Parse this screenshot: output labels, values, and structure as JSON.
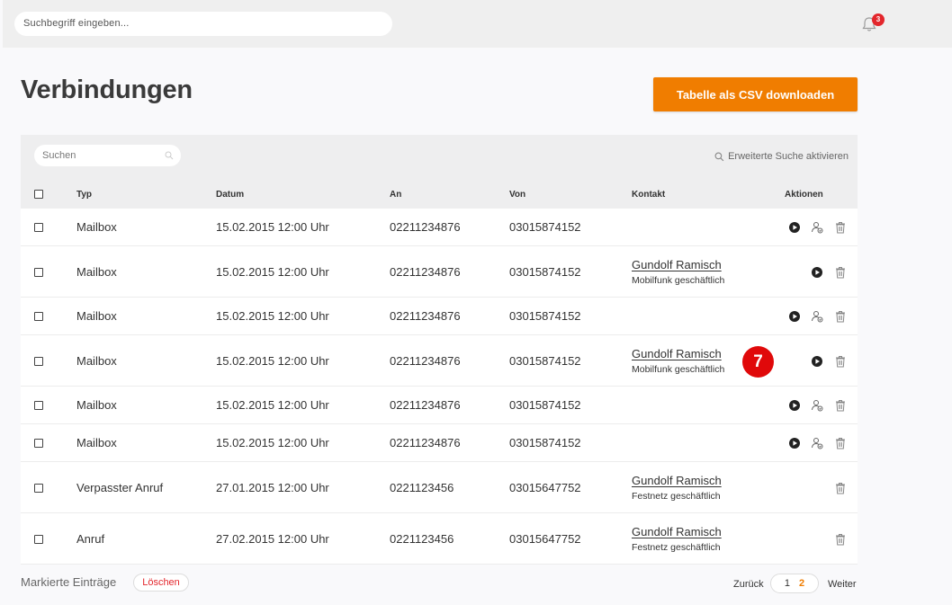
{
  "topbar": {
    "search_placeholder": "Suchbegriff eingeben...",
    "notification_count": "3"
  },
  "page": {
    "title": "Verbindungen",
    "csv_button": "Tabelle als CSV downloaden"
  },
  "table": {
    "search_placeholder": "Suchen",
    "extended_search": "Erweiterte Suche aktivieren",
    "columns": {
      "type": "Typ",
      "date": "Datum",
      "to": "An",
      "from": "Von",
      "contact": "Kontakt",
      "actions": "Aktionen"
    },
    "rows": [
      {
        "type": "Mailbox",
        "date": "15.02.2015 12:00 Uhr",
        "to": "02211234876",
        "from": "03015874152",
        "contact_name": "",
        "contact_sub": "",
        "actions": [
          "play",
          "assign",
          "delete"
        ]
      },
      {
        "type": "Mailbox",
        "date": "15.02.2015 12:00 Uhr",
        "to": "02211234876",
        "from": "03015874152",
        "contact_name": "Gundolf Ramisch",
        "contact_sub": "Mobilfunk geschäftlich",
        "actions": [
          "play",
          "delete"
        ]
      },
      {
        "type": "Mailbox",
        "date": "15.02.2015 12:00 Uhr",
        "to": "02211234876",
        "from": "03015874152",
        "contact_name": "",
        "contact_sub": "",
        "actions": [
          "play",
          "assign",
          "delete"
        ]
      },
      {
        "type": "Mailbox",
        "date": "15.02.2015 12:00 Uhr",
        "to": "02211234876",
        "from": "03015874152",
        "contact_name": "Gundolf Ramisch",
        "contact_sub": "Mobilfunk geschäftlich",
        "actions": [
          "play",
          "delete"
        ]
      },
      {
        "type": "Mailbox",
        "date": "15.02.2015 12:00 Uhr",
        "to": "02211234876",
        "from": "03015874152",
        "contact_name": "",
        "contact_sub": "",
        "actions": [
          "play",
          "assign",
          "delete"
        ]
      },
      {
        "type": "Mailbox",
        "date": "15.02.2015 12:00 Uhr",
        "to": "02211234876",
        "from": "03015874152",
        "contact_name": "",
        "contact_sub": "",
        "actions": [
          "play",
          "assign",
          "delete"
        ]
      },
      {
        "type": "Verpasster Anruf",
        "date": "27.01.2015 12:00 Uhr",
        "to": "0221123456",
        "from": "03015647752",
        "contact_name": "Gundolf Ramisch",
        "contact_sub": "Festnetz geschäftlich",
        "actions": [
          "delete"
        ]
      },
      {
        "type": "Anruf",
        "date": "27.02.2015 12:00 Uhr",
        "to": "0221123456",
        "from": "03015647752",
        "contact_name": "Gundolf Ramisch",
        "contact_sub": "Festnetz geschäftlich",
        "actions": [
          "delete"
        ]
      }
    ]
  },
  "annotation": {
    "step": "7"
  },
  "footer": {
    "marked_label": "Markierte Einträge",
    "delete_button": "Löschen",
    "back": "Zurück",
    "pages": [
      "1",
      "2"
    ],
    "next": "Weiter"
  },
  "colors": {
    "accent": "#f07d00",
    "alert": "#e3262c",
    "step_badge": "#e0090a"
  }
}
